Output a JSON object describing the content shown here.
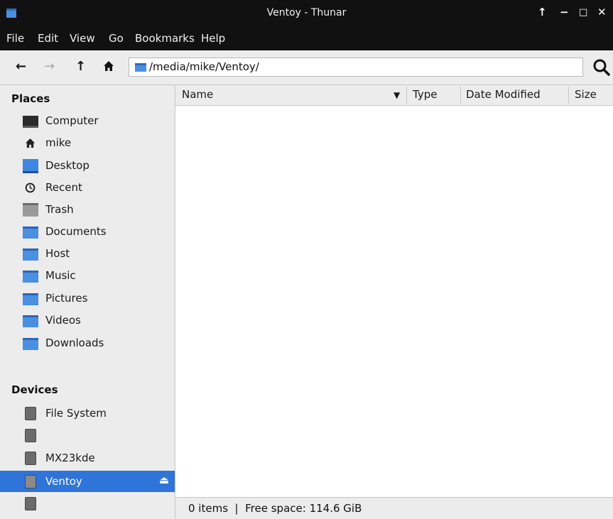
{
  "window": {
    "title": "Ventoy - Thunar",
    "buttons": [
      "↑",
      "−",
      "□",
      "✕"
    ]
  },
  "menubar": {
    "items": [
      "File",
      "Edit",
      "View",
      "Go",
      "Bookmarks",
      "Help"
    ]
  },
  "toolbar": {
    "back_label": "←",
    "forward_label": "→",
    "up_label": "↑",
    "home_label": "⌂",
    "location_path": "/media/mike/Ventoy/",
    "search_icon": "search-icon"
  },
  "sidebar": {
    "places_heading": "Places",
    "places": [
      {
        "label": "Computer",
        "icon": "computer-icon"
      },
      {
        "label": "mike",
        "icon": "home-icon"
      },
      {
        "label": "Desktop",
        "icon": "desktop-icon"
      },
      {
        "label": "Recent",
        "icon": "clock-icon"
      },
      {
        "label": "Trash",
        "icon": "trash-icon"
      },
      {
        "label": "Documents",
        "icon": "documents-folder-icon"
      },
      {
        "label": "Host",
        "icon": "folder-icon"
      },
      {
        "label": "Music",
        "icon": "music-folder-icon"
      },
      {
        "label": "Pictures",
        "icon": "pictures-folder-icon"
      },
      {
        "label": "Videos",
        "icon": "videos-folder-icon"
      },
      {
        "label": "Downloads",
        "icon": "downloads-folder-icon"
      }
    ],
    "devices_heading": "Devices",
    "devices": [
      {
        "label": "File System",
        "icon": "drive-icon"
      },
      {
        "label": "",
        "icon": "drive-icon"
      },
      {
        "label": "MX23kde",
        "icon": "drive-icon"
      },
      {
        "label": "Ventoy",
        "icon": "drive-icon",
        "selected": true
      },
      {
        "label": "",
        "icon": "drive-icon"
      }
    ],
    "eject_label": "⏏"
  },
  "columns": {
    "name": "Name",
    "type": "Type",
    "date_modified": "Date Modified",
    "size": "Size",
    "sort_indicator": "▼"
  },
  "status": {
    "text": "0 items  |  Free space: 114.6 GiB"
  },
  "colors": {
    "titlebar": "#111111",
    "accent": "#2f74d8",
    "folder": "#4a8fe0",
    "panel": "#ececec"
  }
}
